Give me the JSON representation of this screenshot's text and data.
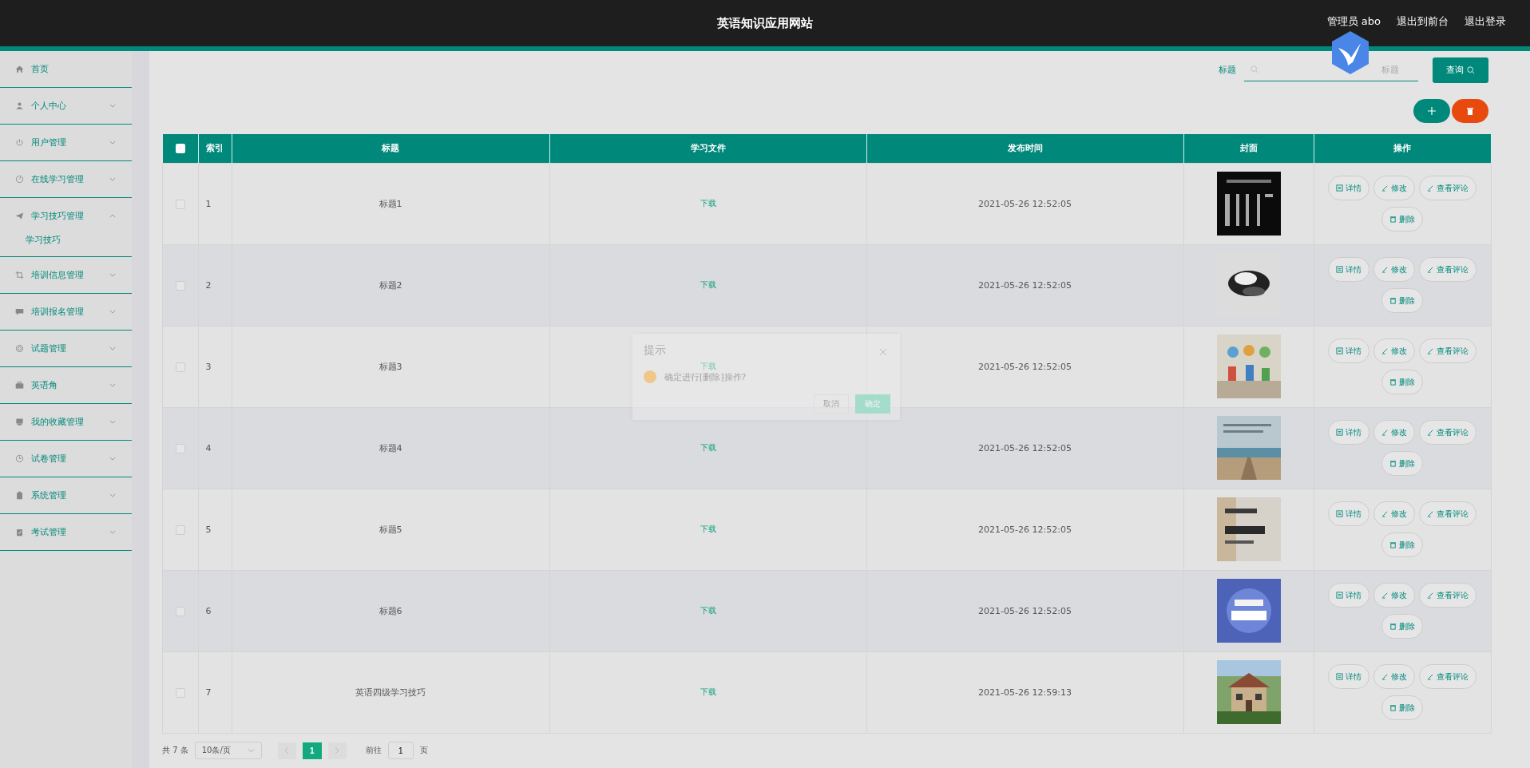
{
  "header": {
    "title": "英语知识应用网站",
    "links": [
      {
        "label": "管理员 abo"
      },
      {
        "label": "退出到前台"
      },
      {
        "label": "退出登录"
      }
    ]
  },
  "sidebar": {
    "items": [
      {
        "label": "首页"
      },
      {
        "label": "个人中心",
        "expanded": false
      },
      {
        "label": "用户管理",
        "expanded": false
      },
      {
        "label": "在线学习管理",
        "expanded": false
      },
      {
        "label": "学习技巧管理",
        "expanded": true,
        "children": [
          {
            "label": "学习技巧"
          }
        ]
      },
      {
        "label": "培训信息管理",
        "expanded": false
      },
      {
        "label": "培训报名管理",
        "expanded": false
      },
      {
        "label": "试题管理",
        "expanded": false
      },
      {
        "label": "英语角",
        "expanded": false
      },
      {
        "label": "我的收藏管理",
        "expanded": false
      },
      {
        "label": "试卷管理",
        "expanded": false
      },
      {
        "label": "系统管理",
        "expanded": false
      },
      {
        "label": "考试管理",
        "expanded": false
      }
    ]
  },
  "search": {
    "label": "标题",
    "placeholder": "标题",
    "button": "查询"
  },
  "table": {
    "columns": [
      "索引",
      "标题",
      "学习文件",
      "发布时间",
      "封面",
      "操作"
    ],
    "all_checked": false,
    "rows": [
      {
        "index": "1",
        "title": "标题1",
        "file": "下载",
        "time": "2021-05-26 12:52:05",
        "checked": false,
        "actions": [
          "详情",
          "修改",
          "查看评论",
          "删除"
        ]
      },
      {
        "index": "2",
        "title": "标题2",
        "file": "下载",
        "time": "2021-05-26 12:52:05",
        "checked": false,
        "actions": [
          "详情",
          "修改",
          "查看评论",
          "删除"
        ]
      },
      {
        "index": "3",
        "title": "标题3",
        "file": "下载",
        "time": "2021-05-26 12:52:05",
        "checked": false,
        "actions": [
          "详情",
          "修改",
          "查看评论",
          "删除"
        ]
      },
      {
        "index": "4",
        "title": "标题4",
        "file": "下载",
        "time": "2021-05-26 12:52:05",
        "checked": false,
        "actions": [
          "详情",
          "修改",
          "查看评论",
          "删除"
        ]
      },
      {
        "index": "5",
        "title": "标题5",
        "file": "下载",
        "time": "2021-05-26 12:52:05",
        "checked": false,
        "actions": [
          "详情",
          "修改",
          "查看评论",
          "删除"
        ]
      },
      {
        "index": "6",
        "title": "标题6",
        "file": "下载",
        "time": "2021-05-26 12:52:05",
        "checked": false,
        "actions": [
          "详情",
          "修改",
          "查看评论",
          "删除"
        ]
      },
      {
        "index": "7",
        "title": "英语四级学习技巧",
        "file": "下载",
        "time": "2021-05-26 12:59:13",
        "checked": false,
        "actions": [
          "详情",
          "修改",
          "查看评论",
          "删除"
        ]
      }
    ]
  },
  "pagination": {
    "total": "共 7 条",
    "page_size": "10条/页",
    "pages": [
      {
        "label": "1",
        "selected": true
      }
    ],
    "goto_label": "前往",
    "goto_value": "1",
    "goto_suffix": "页"
  },
  "dialog": {
    "title": "提示",
    "message": "确定进行[删除]操作?",
    "cancel": "取消",
    "confirm": "确定"
  }
}
